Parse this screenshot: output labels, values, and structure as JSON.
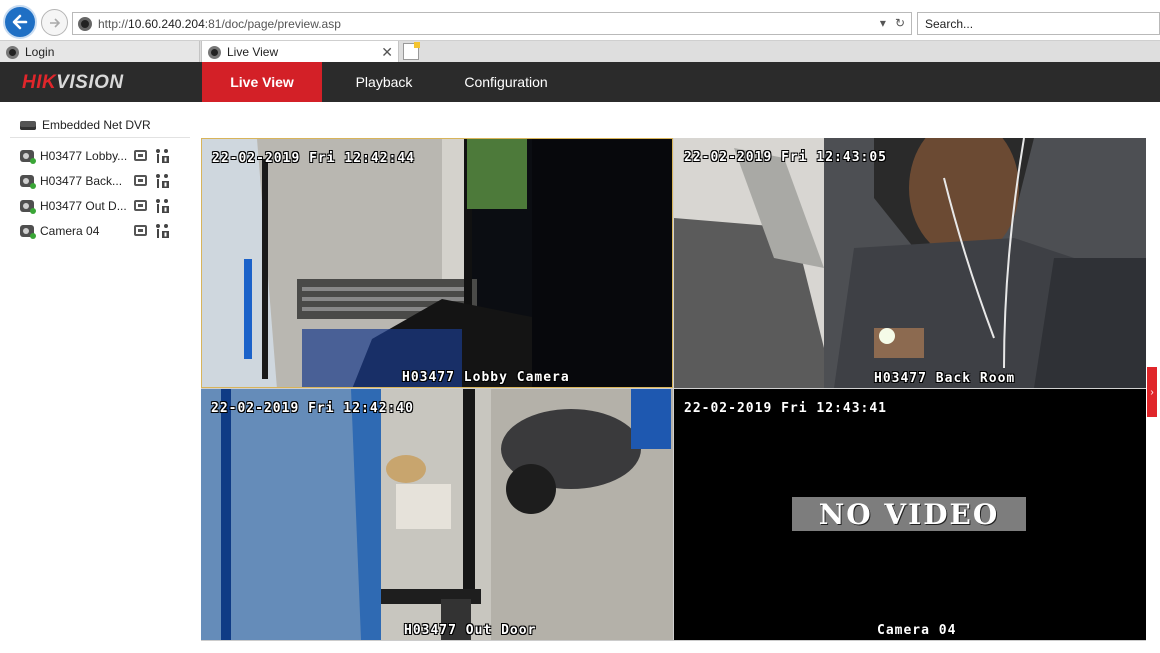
{
  "browser": {
    "url_prefix": "http://",
    "url_host": "10.60.240.204",
    "url_rest": ":81/doc/page/preview.asp",
    "search_placeholder": "Search...",
    "tabs": [
      {
        "label": "Login",
        "icon": "hikvision-favicon"
      },
      {
        "label": "Live View",
        "icon": "hikvision-favicon",
        "close": "✕"
      }
    ]
  },
  "app": {
    "logo_part1": "HIK",
    "logo_part2": "VISION",
    "nav": [
      {
        "label": "Live View",
        "active": true
      },
      {
        "label": "Playback"
      },
      {
        "label": "Configuration"
      }
    ],
    "accent_color": "#d32027"
  },
  "sidebar": {
    "device": "Embedded Net DVR",
    "cameras": [
      {
        "label": "H03477 Lobby Camera",
        "display": "H03477 Lobby..."
      },
      {
        "label": "H03477 Back Room",
        "display": "H03477 Back..."
      },
      {
        "label": "H03477 Out Door",
        "display": "H03477 Out D..."
      },
      {
        "label": "Camera 04",
        "display": "Camera 04"
      }
    ]
  },
  "tiles": [
    {
      "timestamp": "22-02-2019 Fri 12:42:44",
      "name": "H03477 Lobby Camera"
    },
    {
      "timestamp": "22-02-2019 Fri 12:43:05",
      "name": "H03477 Back Room"
    },
    {
      "timestamp": "22-02-2019 Fri 12:42:40",
      "name": "H03477 Out Door"
    },
    {
      "timestamp": "22-02-2019 Fri 12:43:41",
      "name": "Camera 04",
      "no_video": "NO VIDEO"
    }
  ]
}
